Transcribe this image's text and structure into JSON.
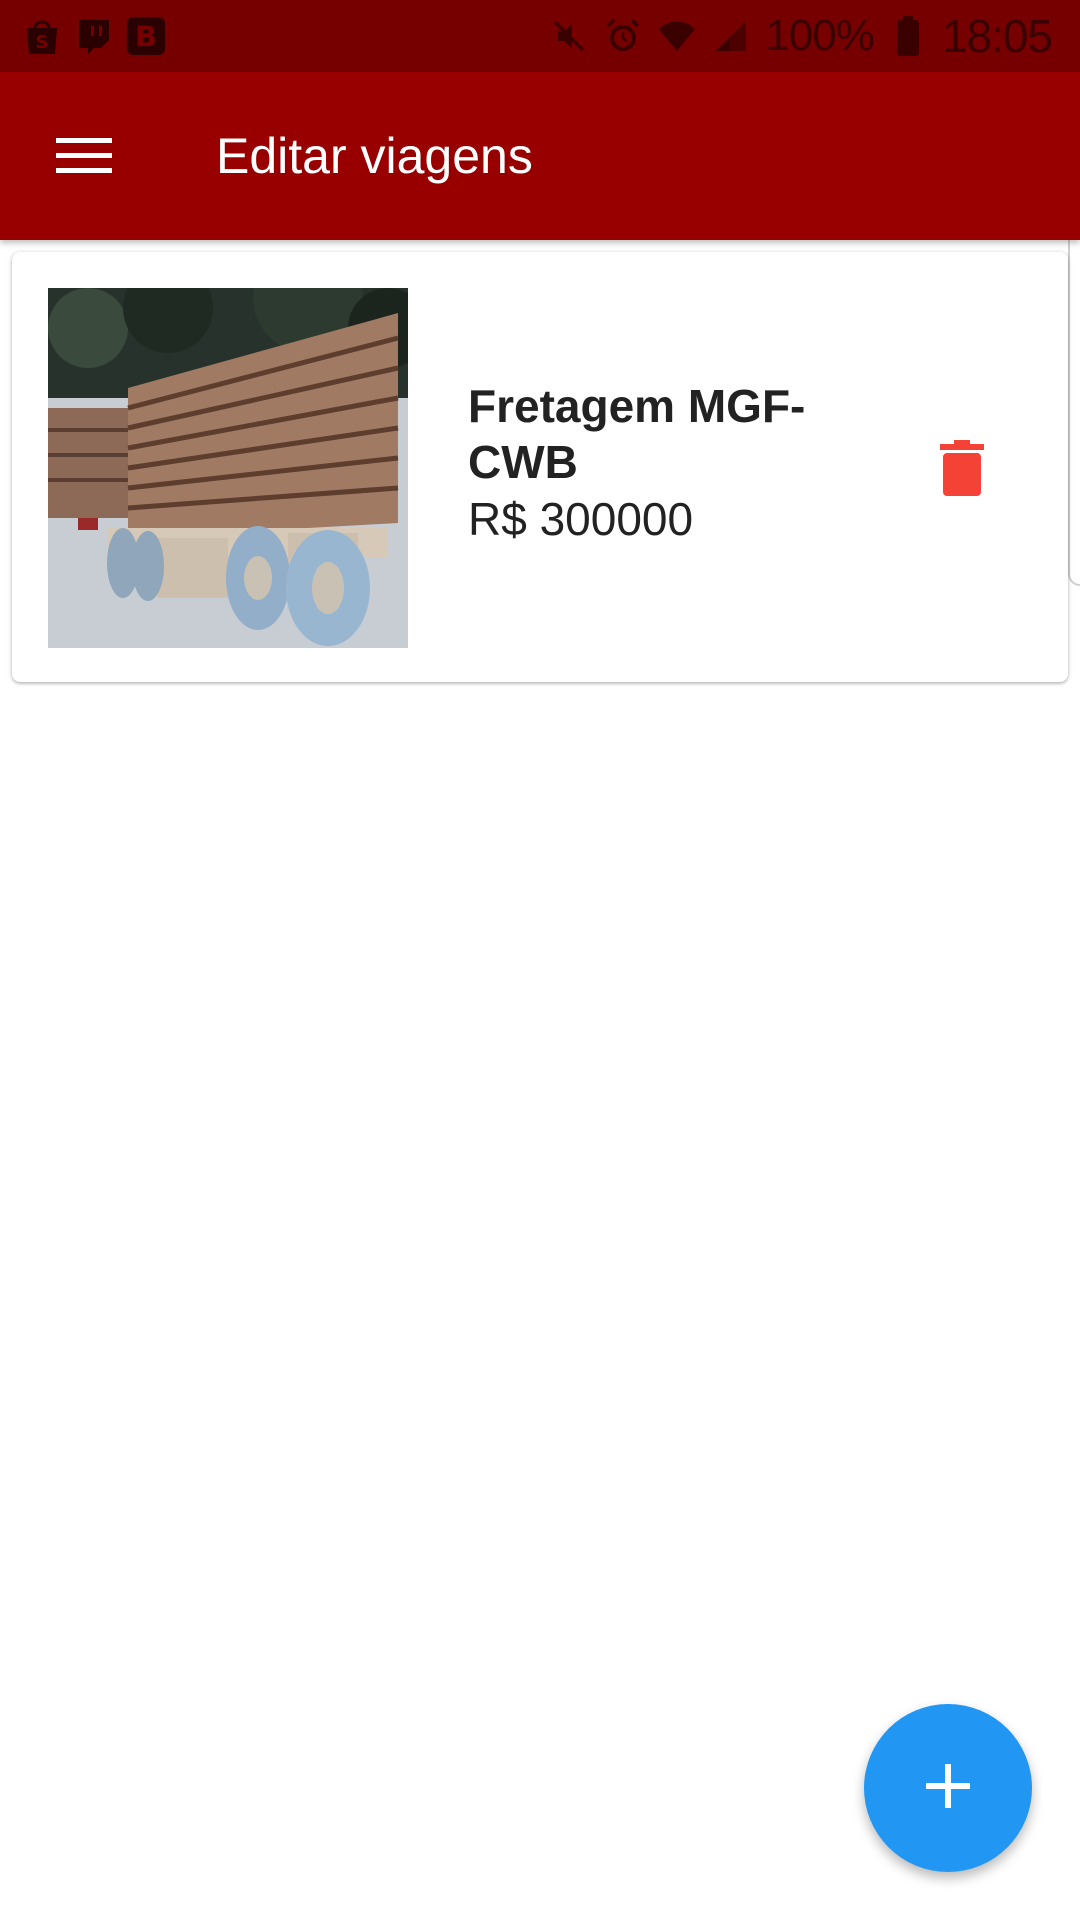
{
  "status_bar": {
    "notification_icons": [
      "shopping-bag-icon",
      "twitch-icon",
      "b-app-icon"
    ],
    "system_icons": [
      "mute-icon",
      "alarm-icon",
      "wifi-icon",
      "signal-icon"
    ],
    "battery": "100%",
    "time": "18:05"
  },
  "app_bar": {
    "title": "Editar viagens",
    "menu_icon": "hamburger-menu-icon"
  },
  "trips": [
    {
      "name": "Fretagem MGF-CWB",
      "price": "R$ 300000",
      "image_icon": "lumber-truck-photo",
      "delete_icon": "trash-icon"
    }
  ],
  "fab": {
    "icon": "plus-icon"
  },
  "colors": {
    "status_bar": "#760000",
    "app_bar": "#980000",
    "delete": "#F44336",
    "fab": "#2196F3",
    "text": "#222222"
  }
}
